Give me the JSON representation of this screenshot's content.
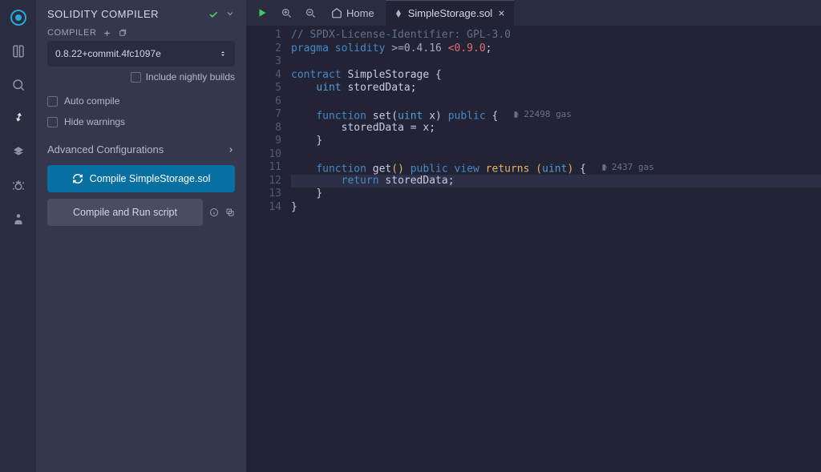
{
  "panel": {
    "title": "SOLIDITY COMPILER",
    "compiler_label": "COMPILER",
    "selected_compiler": "0.8.22+commit.4fc1097e",
    "include_nightly_label": "Include nightly builds",
    "auto_compile_label": "Auto compile",
    "hide_warnings_label": "Hide warnings",
    "advanced_label": "Advanced Configurations",
    "compile_button": "Compile SimpleStorage.sol",
    "compile_run_button": "Compile and Run script"
  },
  "tabs": {
    "home": "Home",
    "file": "SimpleStorage.sol"
  },
  "code": {
    "lines": [
      "// SPDX-License-Identifier: GPL-3.0",
      "pragma solidity >=0.4.16 <0.9.0;",
      "",
      "contract SimpleStorage {",
      "    uint storedData;",
      "",
      "    function set(uint x) public {",
      "        storedData = x;",
      "    }",
      "",
      "    function get() public view returns (uint) {",
      "        return storedData;",
      "    }",
      "}"
    ],
    "gas": {
      "line7": "22498 gas",
      "line11": "2437 gas"
    }
  },
  "colors": {
    "accent": "#086fa1",
    "success": "#46c46b"
  }
}
